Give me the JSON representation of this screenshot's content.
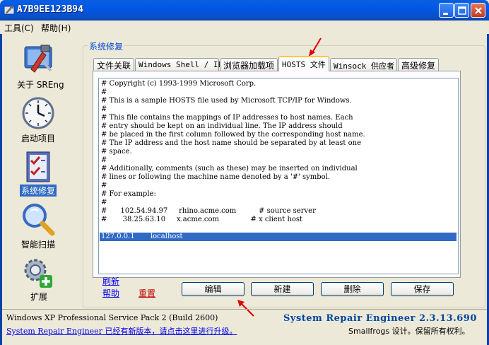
{
  "window": {
    "title": "A7B9EE123B94"
  },
  "menu": [
    {
      "label": "工具(C)"
    },
    {
      "label": "帮助(H)"
    }
  ],
  "sidebar": {
    "items": [
      {
        "label": "关于 SREng",
        "icon": "tools-icon",
        "selected": false
      },
      {
        "label": "启动项目",
        "icon": "clock-icon",
        "selected": false
      },
      {
        "label": "系统修复",
        "icon": "checklist-icon",
        "selected": true
      },
      {
        "label": "智能扫描",
        "icon": "magnifier-icon",
        "selected": false
      },
      {
        "label": "扩展",
        "icon": "gear-plus-icon",
        "selected": false
      }
    ]
  },
  "group": {
    "title": "系统修复"
  },
  "tabs": [
    {
      "label": "文件关联",
      "active": false
    },
    {
      "label": "Windows Shell / IE",
      "active": false
    },
    {
      "label": "浏览器加载项",
      "active": false
    },
    {
      "label": "HOSTS 文件",
      "active": true
    },
    {
      "label": "Winsock 供应者",
      "active": false
    },
    {
      "label": "高级修复",
      "active": false
    }
  ],
  "hosts": {
    "lines": [
      "# Copyright (c) 1993-1999 Microsoft Corp.",
      "#",
      "# This is a sample HOSTS file used by Microsoft TCP/IP for Windows.",
      "#",
      "# This file contains the mappings of IP addresses to host names. Each",
      "# entry should be kept on an individual line. The IP address should",
      "# be placed in the first column followed by the corresponding host name.",
      "# The IP address and the host name should be separated by at least one",
      "# space.",
      "#",
      "# Additionally, comments (such as these) may be inserted on individual",
      "# lines or following the machine name denoted by a '#' symbol.",
      "#",
      "# For example:",
      "#",
      "#      102.54.94.97     rhino.acme.com          # source server",
      "#       38.25.63.10     x.acme.com              # x client host",
      "",
      "127.0.0.1       localhost"
    ],
    "selected_line": 18
  },
  "links": {
    "refresh": "刷新",
    "help": "帮助",
    "reset": "重置"
  },
  "buttons": {
    "edit": "编辑",
    "new": "新建",
    "delete": "删除",
    "save": "保存"
  },
  "status": {
    "os": "Windows XP Professional Service Pack 2 (Build 2600)",
    "update_link_en": "System Repair Engineer",
    "update_link_cn": " 已经有新版本，请点击这里进行升级。",
    "version": "System Repair Engineer 2.3.13.690",
    "copyright": "Smallfrogs 设计。保留所有权利。"
  },
  "colors": {
    "titlebar": "#0058E6",
    "selection": "#316AC5",
    "link": "#0000EE",
    "reset_link": "#C00000",
    "annotation_arrow": "#E00000"
  }
}
